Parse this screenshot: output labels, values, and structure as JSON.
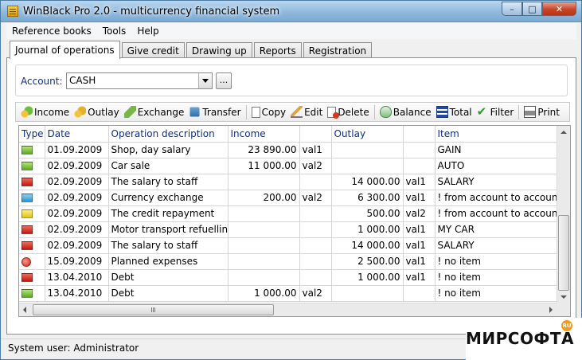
{
  "window": {
    "title": "WinBlack Pro 2.0 - multicurrency financial system",
    "min_glyph": "–",
    "max_glyph": "□",
    "close_glyph": "✕"
  },
  "menu": [
    "Reference books",
    "Tools",
    "Help"
  ],
  "tabs": [
    "Journal of operations",
    "Give credit",
    "Drawing up",
    "Reports",
    "Registration"
  ],
  "account": {
    "label": "Account:",
    "value": "CASH",
    "browse_label": "..."
  },
  "toolbar": {
    "income": "Income",
    "outlay": "Outlay",
    "exchange": "Exchange",
    "transfer": "Transfer",
    "copy": "Copy",
    "edit": "Edit",
    "delete": "Delete",
    "balance": "Balance",
    "total": "Total",
    "filter": "Filter",
    "print": "Print"
  },
  "grid": {
    "columns": [
      "Type",
      "Date",
      "Operation description",
      "Income",
      "",
      "Outlay",
      "",
      "Item"
    ],
    "rows": [
      {
        "type": "green",
        "date": "01.09.2009",
        "desc": "Shop, day salary",
        "income": "23 890.00",
        "income_cur": "val1",
        "outlay": "",
        "outlay_cur": "",
        "item": "GAIN"
      },
      {
        "type": "green",
        "date": "02.09.2009",
        "desc": "Car sale",
        "income": "11 000.00",
        "income_cur": "val2",
        "outlay": "",
        "outlay_cur": "",
        "item": "AUTO"
      },
      {
        "type": "red",
        "date": "02.09.2009",
        "desc": "The salary to staff",
        "income": "",
        "income_cur": "",
        "outlay": "14 000.00",
        "outlay_cur": "val1",
        "item": "SALARY"
      },
      {
        "type": "blue",
        "date": "02.09.2009",
        "desc": "Currency exchange",
        "income": "200.00",
        "income_cur": "val2",
        "outlay": "6 300.00",
        "outlay_cur": "val1",
        "item": "! from account to account"
      },
      {
        "type": "yellow",
        "date": "02.09.2009",
        "desc": "The credit repayment",
        "income": "",
        "income_cur": "",
        "outlay": "500.00",
        "outlay_cur": "val2",
        "item": "! from account to account"
      },
      {
        "type": "red",
        "date": "02.09.2009",
        "desc": "Motor transport refuelling",
        "income": "",
        "income_cur": "",
        "outlay": "1 000.00",
        "outlay_cur": "val1",
        "item": "MY CAR"
      },
      {
        "type": "red",
        "date": "02.09.2009",
        "desc": "The salary to staff",
        "income": "",
        "income_cur": "",
        "outlay": "14 000.00",
        "outlay_cur": "val1",
        "item": "SALARY"
      },
      {
        "type": "circle",
        "date": "15.09.2009",
        "desc": "Planned expenses",
        "income": "",
        "income_cur": "",
        "outlay": "2 500.00",
        "outlay_cur": "val1",
        "item": "! no item"
      },
      {
        "type": "red",
        "date": "13.04.2010",
        "desc": "Debt",
        "income": "",
        "income_cur": "",
        "outlay": "1 000.00",
        "outlay_cur": "val1",
        "item": "! no item"
      },
      {
        "type": "green",
        "date": "13.04.2010",
        "desc": "Debt",
        "income": "1 000.00",
        "income_cur": "val2",
        "outlay": "",
        "outlay_cur": "",
        "item": "! no item"
      }
    ]
  },
  "status": {
    "text": "System user: Administrator"
  },
  "watermark": {
    "text": "МИРСОФТА",
    "badge": "RU"
  }
}
